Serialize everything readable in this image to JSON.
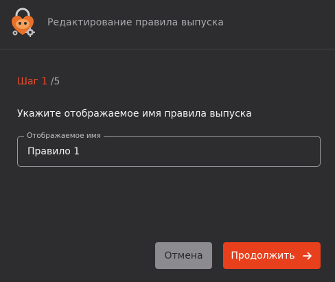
{
  "header": {
    "title": "Редактирование правила выпуска",
    "logo_icon": "lock-gear-mascot-icon"
  },
  "step": {
    "label": "Шаг",
    "current": "1",
    "separator": "/",
    "total": "5"
  },
  "form": {
    "prompt": "Укажите отображаемое имя правила выпуска",
    "display_name_legend": "Отображаемое имя",
    "display_name_value": "Правило 1"
  },
  "actions": {
    "cancel_label": "Отмена",
    "continue_label": "Продолжить",
    "continue_icon": "arrow-right-icon"
  },
  "colors": {
    "background": "#2d2d2f",
    "accent": "#e8401c",
    "step_accent": "#ef4d2d",
    "cancel_button": "#8c8c90"
  }
}
